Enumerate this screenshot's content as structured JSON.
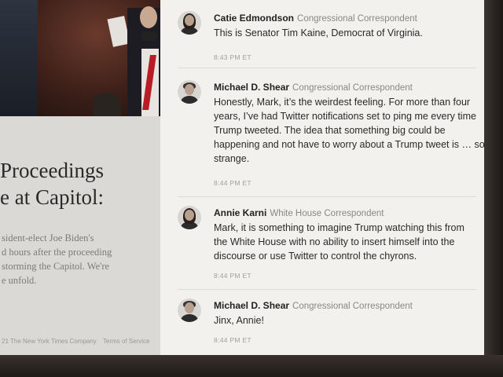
{
  "article": {
    "headline_lines": [
      "Proceedings",
      "e at Capitol:"
    ],
    "summary_lines": [
      "sident-elect Joe Biden's",
      "d hours after the proceeding",
      "storming the Capitol. We're",
      "e unfold."
    ],
    "copyright": "21 The New York Times Company",
    "terms_link": "Terms of Service"
  },
  "posts": [
    {
      "author": "Catie Edmondson",
      "role": "Congressional Correspondent",
      "lines": [
        "This is Senator Tim Kaine, Democrat of Virginia."
      ],
      "time": "8:43 PM ET"
    },
    {
      "author": "Michael D. Shear",
      "role": "Congressional Correspondent",
      "lines": [
        "Honestly, Mark, it’s the weirdest feeling. For more than four",
        "years, I’ve had Twitter notifications set to ping me every time",
        "Trump tweeted. The idea that something big could be",
        "happening and not have to worry about a Trump tweet is … so",
        "strange."
      ],
      "time": "8:44 PM ET"
    },
    {
      "author": "Annie Karni",
      "role": "White House Correspondent",
      "lines": [
        "Mark, it is something to imagine Trump watching this from",
        "the White House with no ability to insert himself into the",
        "discourse or use Twitter to control the chyrons."
      ],
      "time": "8:44 PM ET"
    },
    {
      "author": "Michael D. Shear",
      "role": "Congressional Correspondent",
      "lines": [
        "Jinx, Annie!"
      ],
      "time": "8:44 PM ET"
    }
  ]
}
